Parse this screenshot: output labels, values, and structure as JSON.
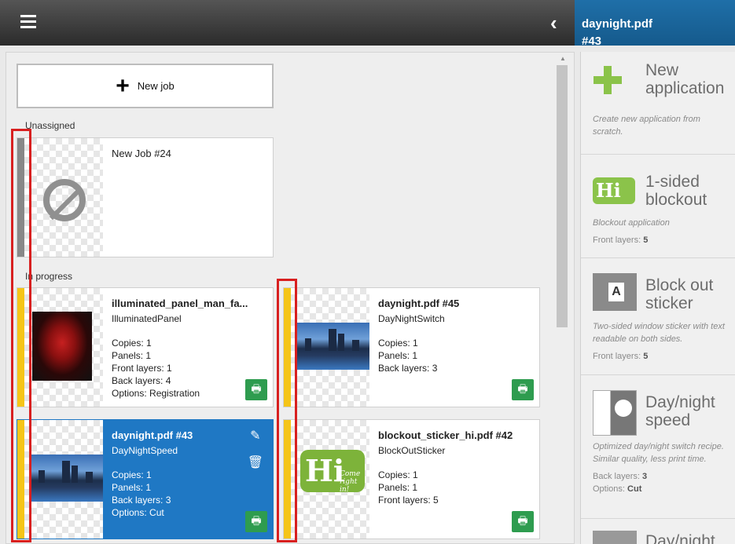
{
  "header": {
    "file": "daynight.pdf",
    "job_no": "#43"
  },
  "new_job": {
    "label": "New job"
  },
  "sections": {
    "unassigned": "Unassigned",
    "in_progress": "In progress"
  },
  "unassigned_card": {
    "name": "New Job #24"
  },
  "jobs": [
    {
      "name": "illuminated_panel_man_fa...",
      "app": "IlluminatedPanel",
      "lines": [
        "Copies: 1",
        "Panels: 1",
        "Front layers: 1",
        "Back layers: 4",
        "Options: Registration"
      ]
    },
    {
      "name": "daynight.pdf #45",
      "app": "DayNightSwitch",
      "lines": [
        "Copies: 1",
        "Panels: 1",
        "Back layers: 3"
      ]
    },
    {
      "name": "daynight.pdf #43",
      "app": "DayNightSpeed",
      "lines": [
        "Copies: 1",
        "Panels: 1",
        "Back layers: 3",
        "Options: Cut"
      ]
    },
    {
      "name": "blockout_sticker_hi.pdf #42",
      "app": "BlockOutSticker",
      "lines": [
        "Copies: 1",
        "Panels: 1",
        "Front layers: 5"
      ]
    }
  ],
  "hi_logo": {
    "big": "Hi",
    "small": "Come right in!"
  },
  "applications": [
    {
      "title": "New application",
      "desc": "Create new application from scratch.",
      "meta": []
    },
    {
      "title": "1-sided blockout",
      "desc": "Blockout application",
      "meta": [
        {
          "k": "Front layers: ",
          "v": "5"
        }
      ]
    },
    {
      "title": "Block out sticker",
      "desc": "Two-sided window sticker with text readable on both sides.",
      "meta": [
        {
          "k": "Front layers: ",
          "v": "5"
        }
      ]
    },
    {
      "title": "Day/night speed",
      "desc": "Optimized day/night switch recipe. Similar quality, less print time.",
      "meta": [
        {
          "k": "Back layers: ",
          "v": "3"
        },
        {
          "k": "Options: ",
          "v": "Cut"
        }
      ]
    },
    {
      "title": "Day/night",
      "desc": "",
      "meta": []
    }
  ],
  "colors": {
    "in_progress_stripe": "#f5c518",
    "unassigned_stripe": "#888888",
    "selected": "#1f78c4",
    "print": "#2e9c4f",
    "highlight": "#d82020"
  }
}
